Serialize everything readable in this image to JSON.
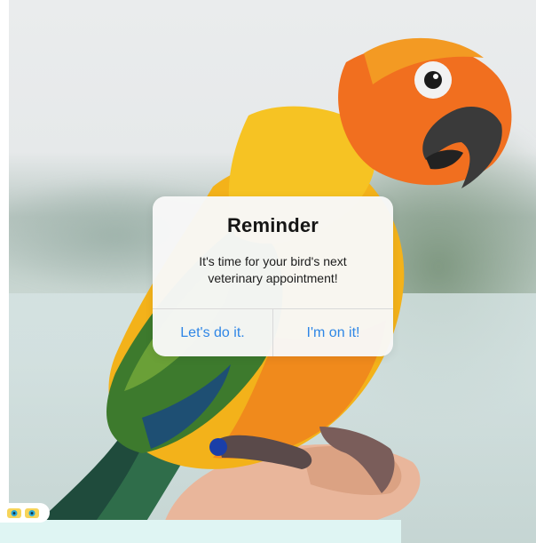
{
  "alert": {
    "title": "Reminder",
    "message": "It's time for your bird's next veterinary appointment!",
    "buttons": [
      {
        "label": "Let's do it."
      },
      {
        "label": "I'm on it!"
      }
    ]
  },
  "colors": {
    "button_text": "#2f86e6",
    "alert_background": "#f8f8f8",
    "bottom_strip": "#dff5f3"
  },
  "icons": {
    "corner_logo": "eyes-logo-icon"
  }
}
